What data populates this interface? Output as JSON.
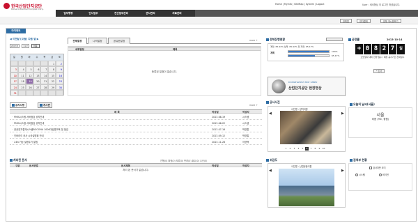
{
  "header": {
    "org_name": "한국산업단지공단",
    "org_sub": "Korea Industrial Complex Corp.",
    "user_msg": "User : 세서형님 이 로그인 하셨습니다.",
    "utils": [
      "Home",
      "Myinfo",
      "SiteMap",
      "System",
      "Logout"
    ],
    "gnb": [
      "업무행정",
      "인사업무",
      "전산업무관리",
      "관사관리",
      "자료관리"
    ]
  },
  "subbar": {
    "buttons": [
      "전체업",
      "전자결재",
      "전체 게시판보기"
    ]
  },
  "my_tab": "마이정보",
  "calendar": {
    "header_text": "◀ 이전달  [오늘]  다음 달 ▶",
    "year": "2013",
    "month": "11",
    "go_label": "이동",
    "weekdays": [
      "일",
      "월",
      "화",
      "수",
      "목",
      "금",
      "토"
    ],
    "weeks": [
      [
        "",
        "",
        "",
        "",
        "",
        "1",
        "2"
      ],
      [
        "3",
        "4",
        "5",
        "6",
        "7",
        "8",
        "9"
      ],
      [
        "10",
        "11",
        "12",
        "13",
        "14",
        "15",
        "16"
      ],
      [
        "17",
        "18",
        "19",
        "20",
        "21",
        "22",
        "23"
      ],
      [
        "24",
        "25",
        "26",
        "27",
        "28",
        "29",
        "30"
      ],
      [
        "31",
        "",
        "",
        "",
        "",
        "",
        ""
      ]
    ],
    "today": "19"
  },
  "schedule": {
    "tabs": [
      "전체일정",
      "나의일정",
      "공유한일정"
    ],
    "more": "more +",
    "col_title": "제목",
    "col_time": "세부일정",
    "empty": "등록된 일정이 없습니다."
  },
  "notice": {
    "tabs": [
      "공지사항",
      "게시판"
    ],
    "more": "more +",
    "cols": [
      "제 목",
      "작성일",
      "작성자"
    ],
    "rows": [
      {
        "title": "· PMIS시스템 서버점검 공지안내",
        "date": "2013-06-19",
        "writer": "시스템"
      },
      {
        "title": "· PMIS시스템 서버점검 공지안내",
        "date": "2013-06-22",
        "writer": "시스템"
      },
      {
        "title": "· 관공전자결재시스템BOOONA 1000대설명교육 및 점검",
        "date": "2013-07-16",
        "writer": "박영철"
      },
      {
        "title": "· 인바라이 공사 시공설명회 안내",
        "date": "2013-09-12",
        "writer": "박영철"
      },
      {
        "title": "· 24hr기능 설명주기 알림",
        "date": "2013-11-28",
        "writer": "이영택"
      }
    ]
  },
  "approval": {
    "title": "처리된 문서",
    "tabs": "진행(0)  확정(0)  보류(0)  반려(0)  회수(0)  수신(0)",
    "cols": [
      "구분",
      "문서번호",
      "문서제목",
      "작성일",
      "작성자"
    ],
    "empty": "처리 된 문서가 없습니다."
  },
  "progress": {
    "title": "전체진행현황",
    "line1": "계획: 65.94%  실적: 65.94%  전 계획: 65.17%",
    "plan_label": "계획",
    "plan_pct": 100,
    "plan_text": "100%",
    "actual_pct": 65.17,
    "actual_text": "65.17%"
  },
  "cctv": {
    "label": "Construction live video",
    "text": "산업단지공단 현장영상"
  },
  "photo": {
    "title": "공사사진",
    "caption": "사진명 : 양치리방",
    "pages": [
      "1",
      "2",
      "3",
      "4",
      "5",
      "6",
      "7",
      "8",
      "9",
      "10"
    ],
    "current": "6"
  },
  "overview": {
    "title": "조감도",
    "caption": "사진명 : 산업공종식원"
  },
  "countdown": {
    "title": "공정률",
    "date": "2013-10-14",
    "digits": [
      "+",
      "0",
      "8",
      "2",
      "7",
      "일"
    ],
    "status": "오늘일자 대비 진행 일수 / 예정 공사기간 잔여일수",
    "note": "* 조사"
  },
  "weather": {
    "title": "오늘의 날씨(서울)",
    "city": "서울",
    "desc": "비옴 (9도, 좋음)"
  },
  "search": {
    "title": "검색부 현황",
    "check_label": "검사자만 보기",
    "radio1": "시스템",
    "radio2": "비이전"
  },
  "colors": {
    "brand": "#c8102e",
    "accent": "#2e6da4",
    "today": "#8f6ba9"
  }
}
